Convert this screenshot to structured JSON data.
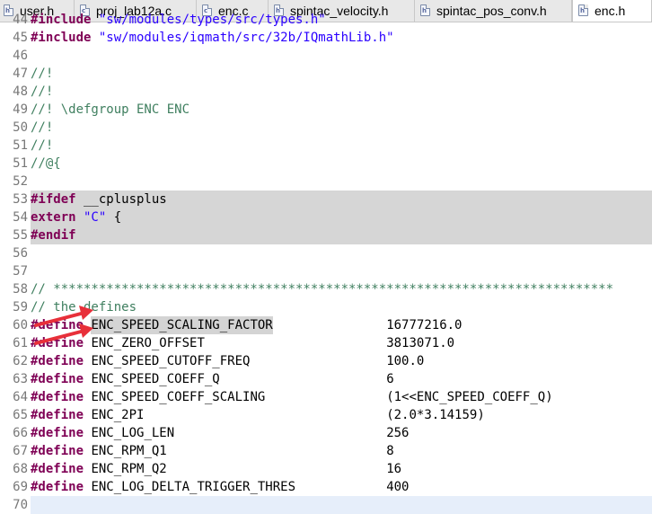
{
  "tabs": [
    {
      "label": "user.h",
      "active": false
    },
    {
      "label": "proj_lab12a.c",
      "active": false
    },
    {
      "label": "enc.c",
      "active": false
    },
    {
      "label": "spintac_velocity.h",
      "active": false
    },
    {
      "label": "spintac_pos_conv.h",
      "active": false
    },
    {
      "label": "enc.h",
      "active": true
    }
  ],
  "close_glyph": "✕",
  "lines": [
    {
      "n": "44",
      "a": "#include",
      "b": "\"sw/modules/types/src/types.h\""
    },
    {
      "n": "45",
      "a": "#include",
      "b": "\"sw/modules/iqmath/src/32b/IQmathLib.h\""
    },
    {
      "n": "46"
    },
    {
      "n": "47",
      "c": "//!"
    },
    {
      "n": "48",
      "c": "//!"
    },
    {
      "n": "49",
      "c": "//! \\defgroup ENC ENC"
    },
    {
      "n": "50",
      "c": "//!"
    },
    {
      "n": "51",
      "c": "//!"
    },
    {
      "n": "51",
      "c": "//@{"
    },
    {
      "n": "52"
    },
    {
      "n": "53",
      "a": "#ifdef",
      "p": "__cplusplus"
    },
    {
      "n": "54",
      "k": "extern",
      "b": "\"C\"",
      "p": "{"
    },
    {
      "n": "55",
      "a": "#endif"
    },
    {
      "n": "56"
    },
    {
      "n": "57"
    },
    {
      "n": "58",
      "c": "// **************************************************************************"
    },
    {
      "n": "59",
      "c": "// the defines"
    },
    {
      "n": "60",
      "a": "#define",
      "m": "ENC_SPEED_SCALING_FACTOR",
      "v": "16777216.0"
    },
    {
      "n": "61",
      "a": "#define",
      "m": "ENC_ZERO_OFFSET",
      "v": "3813071.0"
    },
    {
      "n": "62",
      "a": "#define",
      "m": "ENC_SPEED_CUTOFF_FREQ",
      "v": "100.0"
    },
    {
      "n": "63",
      "a": "#define",
      "m": "ENC_SPEED_COEFF_Q",
      "v": "6"
    },
    {
      "n": "64",
      "a": "#define",
      "m": "ENC_SPEED_COEFF_SCALING",
      "v": "(1<<ENC_SPEED_COEFF_Q)"
    },
    {
      "n": "65",
      "a": "#define",
      "m": "ENC_2PI",
      "v": "(2.0*3.14159)"
    },
    {
      "n": "66",
      "a": "#define",
      "m": "ENC_LOG_LEN",
      "v": "256"
    },
    {
      "n": "67",
      "a": "#define",
      "m": "ENC_RPM_Q1",
      "v": "8"
    },
    {
      "n": "68",
      "a": "#define",
      "m": "ENC_RPM_Q2",
      "v": "16"
    },
    {
      "n": "69",
      "a": "#define",
      "m": "ENC_LOG_DELTA_TRIGGER_THRES",
      "v": "400"
    },
    {
      "n": "70"
    }
  ],
  "colors": {
    "keyword": "#7f0055",
    "string": "#2a00ff",
    "comment": "#3f7f5f",
    "line_number": "#787878",
    "block_highlight": "#d6d6d6",
    "annotation_arrow": "#e8303a"
  }
}
